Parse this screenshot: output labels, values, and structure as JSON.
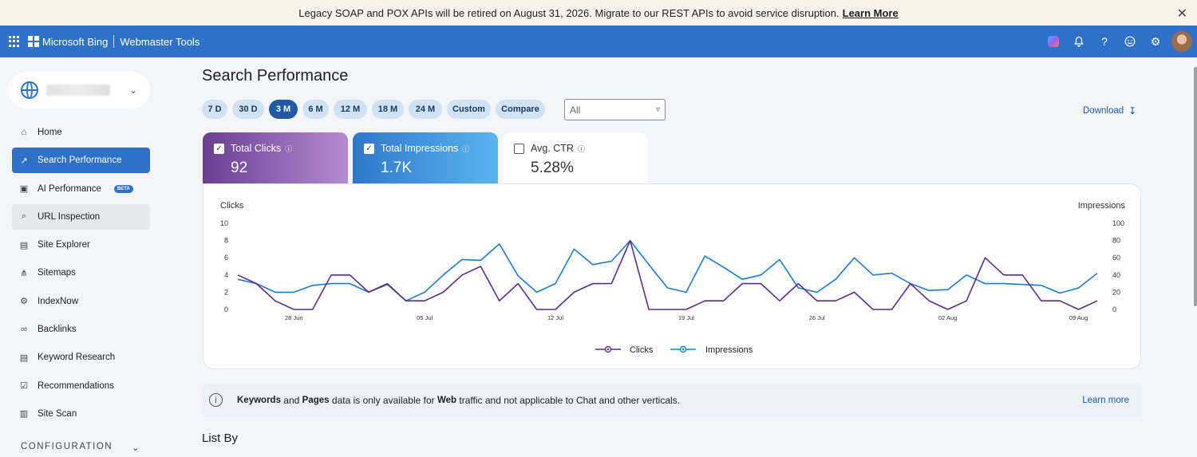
{
  "banner": {
    "message": "Legacy SOAP and POX APIs will be retired on August 31, 2026. Migrate to our REST APIs to avoid service disruption.",
    "link_label": "Learn More",
    "close_icon": "close-icon"
  },
  "topbar": {
    "brand": "Microsoft Bing",
    "product": "Webmaster Tools",
    "icons": [
      "copilot-icon",
      "bell-icon",
      "help-icon",
      "smiley-icon",
      "gear-icon",
      "avatar"
    ]
  },
  "sidebar": {
    "items": [
      {
        "label": "Home",
        "icon": "home-icon"
      },
      {
        "label": "Search Performance",
        "icon": "trend-icon",
        "active": true
      },
      {
        "label": "AI Performance",
        "icon": "ai-icon",
        "badge": "BETA"
      },
      {
        "label": "URL Inspection",
        "icon": "search-icon",
        "hover": true
      },
      {
        "label": "Site Explorer",
        "icon": "document-icon"
      },
      {
        "label": "Sitemaps",
        "icon": "sitemap-icon"
      },
      {
        "label": "IndexNow",
        "icon": "gear-icon"
      },
      {
        "label": "Backlinks",
        "icon": "link-icon"
      },
      {
        "label": "Keyword Research",
        "icon": "document-icon"
      },
      {
        "label": "Recommendations",
        "icon": "checklist-icon"
      },
      {
        "label": "Site Scan",
        "icon": "scan-icon"
      }
    ],
    "section": "CONFIGURATION"
  },
  "main": {
    "title": "Search Performance",
    "ranges": [
      "7 D",
      "30 D",
      "3 M",
      "6 M",
      "12 M",
      "18 M",
      "24 M",
      "Custom",
      "Compare"
    ],
    "selected_range": "3 M",
    "filter_value": "All",
    "download_label": "Download",
    "metrics": [
      {
        "label": "Total Clicks",
        "value": "92",
        "checked": true
      },
      {
        "label": "Total Impressions",
        "value": "1.7K",
        "checked": true
      },
      {
        "label": "Avg. CTR",
        "value": "5.28%",
        "checked": false
      }
    ],
    "notice": {
      "bold1": "Keywords",
      "text1": " and ",
      "bold2": "Pages",
      "text2": " data is only available for ",
      "bold3": "Web",
      "text3": " traffic and not applicable to Chat and other verticals.",
      "link": "Learn more"
    },
    "list_by": "List By"
  },
  "colors": {
    "accent": "#2f71c8",
    "clicks": "#5b2d87",
    "impressions": "#1f7bd0"
  },
  "chart_data": {
    "type": "line",
    "ylabel_left": "Clicks",
    "ylabel_right": "Impressions",
    "y_left_ticks": [
      "10",
      "8",
      "6",
      "4",
      "2",
      "0"
    ],
    "y_right_ticks": [
      "100",
      "80",
      "60",
      "40",
      "20",
      "0"
    ],
    "ylim_left": [
      0,
      10
    ],
    "ylim_right": [
      0,
      100
    ],
    "x_tick_labels": [
      "28 Jun",
      "05 Jul",
      "12 Jul",
      "19 Jul",
      "26 Jul",
      "02 Aug",
      "09 Aug"
    ],
    "x_tick_index": [
      3,
      10,
      17,
      24,
      31,
      38,
      45
    ],
    "legend_position": "bottom",
    "series": [
      {
        "name": "Clicks",
        "axis": "left",
        "color": "#5b2d87",
        "values": [
          4,
          3,
          1,
          0,
          0,
          4,
          4,
          2,
          3,
          1,
          1,
          2,
          4,
          5,
          1,
          3,
          0,
          0,
          2,
          3,
          3,
          8,
          0,
          0,
          0,
          1,
          1,
          3,
          3,
          1,
          3,
          1,
          1,
          2,
          0,
          0,
          3,
          1,
          0,
          1,
          6,
          4,
          4,
          1,
          1,
          0,
          1
        ]
      },
      {
        "name": "Impressions",
        "axis": "right",
        "color": "#1f7bd0",
        "values": [
          35,
          30,
          20,
          20,
          28,
          30,
          30,
          20,
          29,
          10,
          20,
          40,
          58,
          57,
          76,
          39,
          20,
          30,
          70,
          52,
          56,
          80,
          52,
          25,
          20,
          62,
          49,
          35,
          40,
          58,
          25,
          20,
          35,
          60,
          40,
          42,
          30,
          22,
          23,
          40,
          30,
          30,
          29,
          28,
          19,
          25,
          42
        ]
      }
    ]
  }
}
